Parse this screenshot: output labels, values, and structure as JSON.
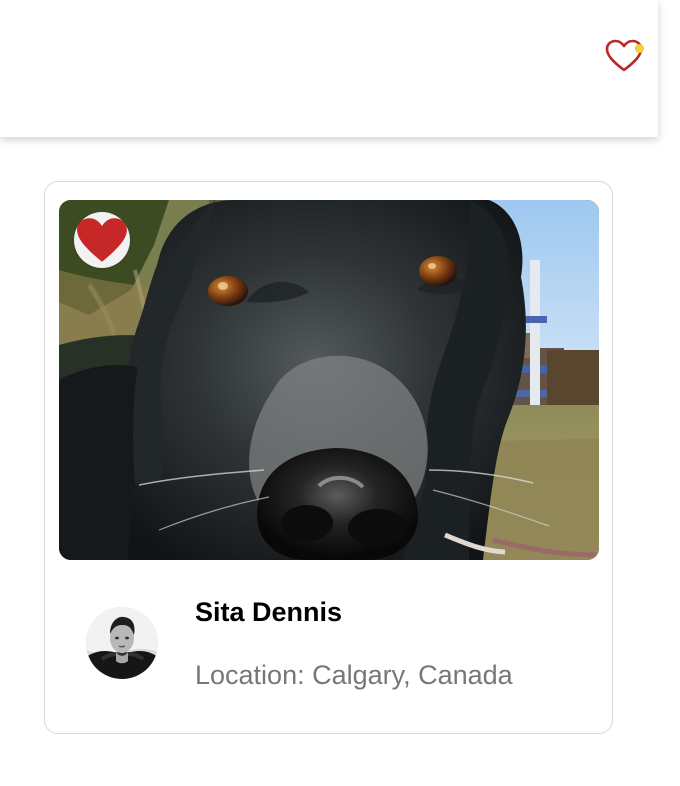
{
  "header": {
    "favorites_icon": "heart-outline-icon",
    "notification_color": "#f6d33c"
  },
  "card": {
    "image": "black-dog-close-up",
    "liked": true,
    "like_icon": "heart-filled-icon",
    "accent_color": "#c62828",
    "owner": {
      "name": "Sita Dennis",
      "location": "Location: Calgary, Canada",
      "avatar": "man-portrait-avatar"
    }
  }
}
